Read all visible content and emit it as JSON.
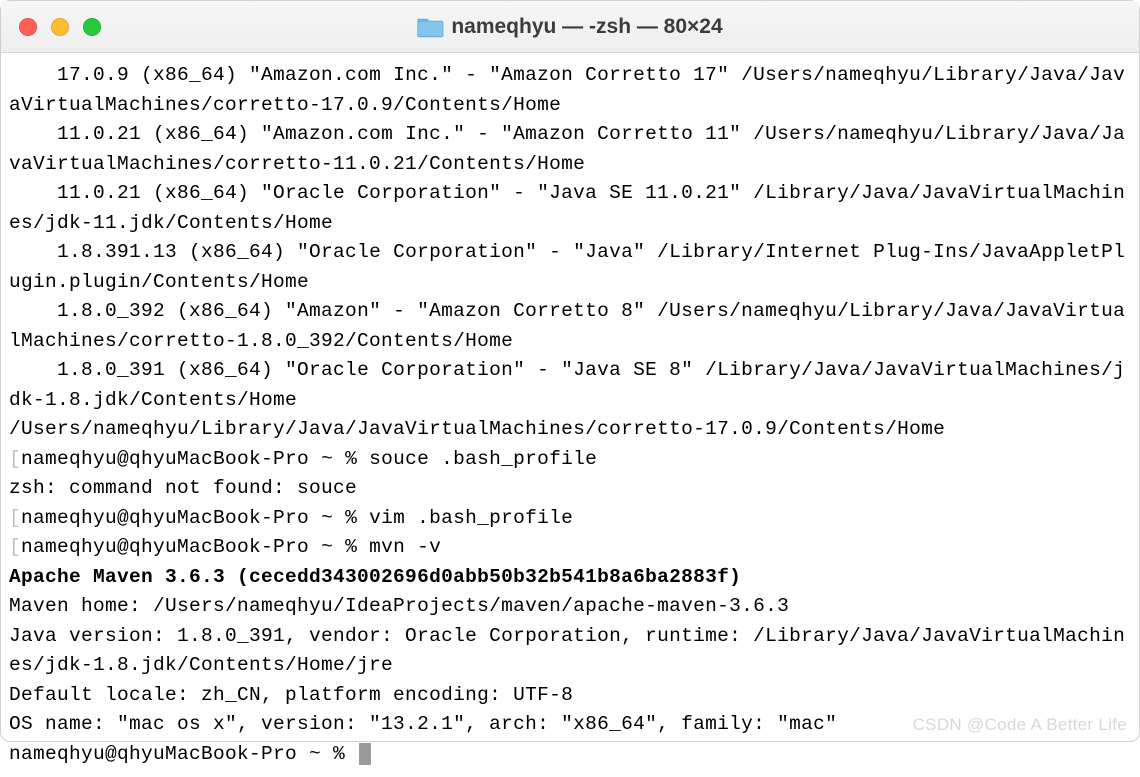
{
  "window": {
    "title": "nameqhyu — -zsh — 80×24"
  },
  "terminal": {
    "lines": [
      "    17.0.9 (x86_64) \"Amazon.com Inc.\" - \"Amazon Corretto 17\" /Users/nameqhyu/Library/Java/JavaVirtualMachines/corretto-17.0.9/Contents/Home",
      "    11.0.21 (x86_64) \"Amazon.com Inc.\" - \"Amazon Corretto 11\" /Users/nameqhyu/Library/Java/JavaVirtualMachines/corretto-11.0.21/Contents/Home",
      "    11.0.21 (x86_64) \"Oracle Corporation\" - \"Java SE 11.0.21\" /Library/Java/JavaVirtualMachines/jdk-11.jdk/Contents/Home",
      "    1.8.391.13 (x86_64) \"Oracle Corporation\" - \"Java\" /Library/Internet Plug-Ins/JavaAppletPlugin.plugin/Contents/Home",
      "    1.8.0_392 (x86_64) \"Amazon\" - \"Amazon Corretto 8\" /Users/nameqhyu/Library/Java/JavaVirtualMachines/corretto-1.8.0_392/Contents/Home",
      "    1.8.0_391 (x86_64) \"Oracle Corporation\" - \"Java SE 8\" /Library/Java/JavaVirtualMachines/jdk-1.8.jdk/Contents/Home",
      "/Users/nameqhyu/Library/Java/JavaVirtualMachines/corretto-17.0.9/Contents/Home"
    ],
    "prompt1": {
      "prefix": "nameqhyu@qhyuMacBook-Pro ~ % ",
      "cmd": "souce .bash_profile"
    },
    "error1": "zsh: command not found: souce",
    "prompt2": {
      "prefix": "nameqhyu@qhyuMacBook-Pro ~ % ",
      "cmd": "vim .bash_profile"
    },
    "prompt3": {
      "prefix": "nameqhyu@qhyuMacBook-Pro ~ % ",
      "cmd": "mvn -v"
    },
    "maven_bold": "Apache Maven 3.6.3 (cecedd343002696d0abb50b32b541b8a6ba2883f)",
    "maven_lines": [
      "Maven home: /Users/nameqhyu/IdeaProjects/maven/apache-maven-3.6.3",
      "Java version: 1.8.0_391, vendor: Oracle Corporation, runtime: /Library/Java/JavaVirtualMachines/jdk-1.8.jdk/Contents/Home/jre",
      "Default locale: zh_CN, platform encoding: UTF-8",
      "OS name: \"mac os x\", version: \"13.2.1\", arch: \"x86_64\", family: \"mac\""
    ],
    "prompt4": {
      "prefix": "nameqhyu@qhyuMacBook-Pro ~ % "
    }
  },
  "watermark": "CSDN @Code A Better Life"
}
